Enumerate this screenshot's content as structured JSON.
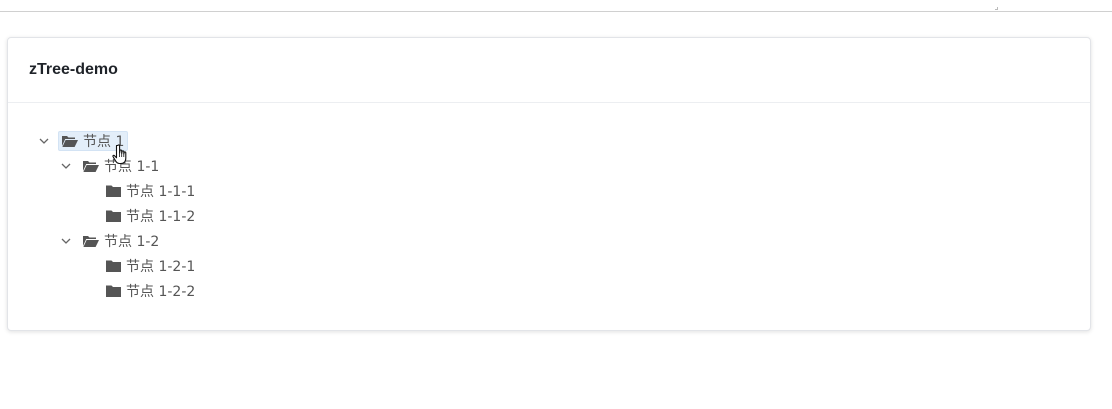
{
  "panel": {
    "title": "zTree-demo"
  },
  "tree": {
    "root": {
      "label": "节点 1",
      "icon": "folder-open-icon",
      "selected": true,
      "children": [
        {
          "label": "节点 1-1",
          "icon": "folder-open-icon",
          "children": [
            {
              "label": "节点 1-1-1",
              "icon": "folder-icon"
            },
            {
              "label": "节点 1-1-2",
              "icon": "folder-icon"
            }
          ]
        },
        {
          "label": "节点 1-2",
          "icon": "folder-open-icon",
          "children": [
            {
              "label": "节点 1-2-1",
              "icon": "folder-icon"
            },
            {
              "label": "节点 1-2-2",
              "icon": "folder-icon"
            }
          ]
        }
      ]
    }
  },
  "colors": {
    "selected_bg": "#e3eef9",
    "icon": "#555555",
    "title": "#1f2329"
  }
}
